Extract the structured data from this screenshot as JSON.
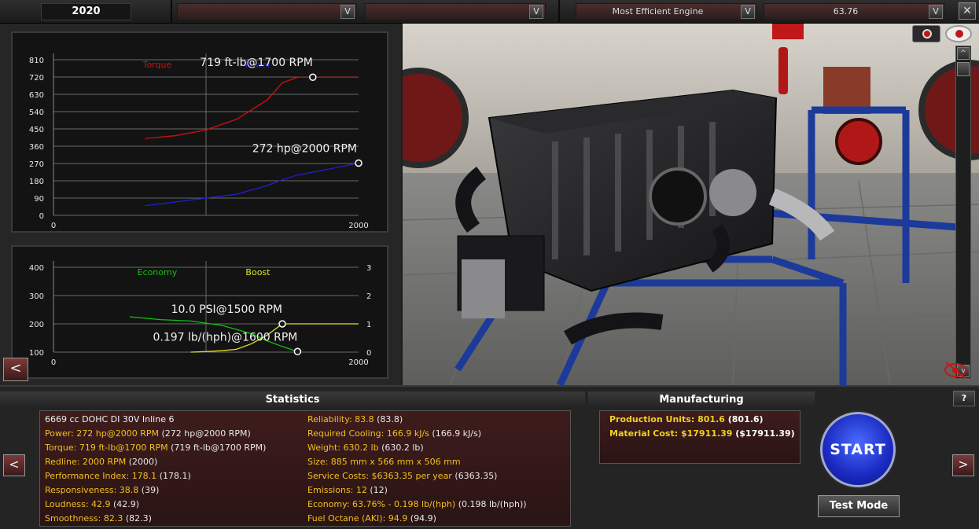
{
  "topbar": {
    "year": "2020",
    "dropdown1": "",
    "dropdown2": "",
    "dropdown3": "Most Efficient Engine",
    "dropdown4": "63.76",
    "arrow_glyph": "V",
    "close_glyph": "✕"
  },
  "chart_data": [
    {
      "type": "line",
      "title": "",
      "xlim": [
        0,
        2000
      ],
      "ylim": [
        0,
        810
      ],
      "x_ticks": [
        "0",
        "2000"
      ],
      "y_ticks": [
        "810",
        "720",
        "630",
        "540",
        "450",
        "360",
        "270",
        "180",
        "90",
        "0"
      ],
      "series": [
        {
          "name": "Torque",
          "color": "#d01010",
          "x": [
            600,
            800,
            1000,
            1200,
            1400,
            1500,
            1600,
            1700,
            1800,
            2000
          ],
          "y": [
            400,
            415,
            445,
            500,
            600,
            690,
            719,
            719,
            719,
            719
          ]
        },
        {
          "name": "Power",
          "color": "#2020d0",
          "x": [
            600,
            800,
            1000,
            1200,
            1400,
            1500,
            1600,
            1800,
            2000
          ],
          "y": [
            50,
            70,
            90,
            110,
            155,
            185,
            210,
            240,
            272
          ]
        }
      ],
      "annotations": [
        {
          "text": "719 ft-lb@1700 RPM",
          "x": 1700,
          "y": 719
        },
        {
          "text": "272 hp@2000 RPM",
          "x": 2000,
          "y": 272
        }
      ]
    },
    {
      "type": "line",
      "title": "",
      "xlim": [
        0,
        2000
      ],
      "ylim": [
        100,
        400
      ],
      "y2lim": [
        0,
        3
      ],
      "x_ticks": [
        "0",
        "2000"
      ],
      "y_ticks": [
        "400",
        "300",
        "200",
        "100"
      ],
      "y2_ticks": [
        "3",
        "2",
        "1",
        "0"
      ],
      "series": [
        {
          "name": "Economy",
          "color": "#10c010",
          "axis": "left",
          "x": [
            500,
            700,
            900,
            1100,
            1300,
            1400,
            1500,
            1600
          ],
          "y": [
            225,
            215,
            210,
            195,
            165,
            140,
            120,
            102
          ]
        },
        {
          "name": "Boost",
          "color": "#e0e020",
          "axis": "right",
          "x": [
            900,
            1000,
            1100,
            1200,
            1300,
            1400,
            1500,
            1700,
            2000
          ],
          "y": [
            0.0,
            0.02,
            0.05,
            0.1,
            0.3,
            0.6,
            1.0,
            1.0,
            1.0
          ]
        }
      ],
      "annotations": [
        {
          "text": "10.0 PSI@1500 RPM",
          "x": 1500,
          "y": 1.0,
          "axis": "right"
        },
        {
          "text": "0.197 lb/(hph)@1600 RPM",
          "x": 1600,
          "y": 102,
          "axis": "left"
        }
      ]
    }
  ],
  "left": {
    "back_glyph": "<"
  },
  "viewport": {
    "up_glyph": "^",
    "down_glyph": "v",
    "camera_icon": "camera-icon",
    "eye_icon": "eye-icon"
  },
  "statistics": {
    "header": "Statistics",
    "left_col": [
      {
        "label": "6669 cc DOHC DI 30V Inline 6",
        "base": ""
      },
      {
        "label": "Power: 272 hp@2000 RPM",
        "base": "(272 hp@2000 RPM)"
      },
      {
        "label": "Torque: 719 ft-lb@1700 RPM",
        "base": "(719 ft-lb@1700 RPM)"
      },
      {
        "label": "Redline: 2000 RPM",
        "base": "(2000)"
      },
      {
        "label": "Performance Index: 178.1",
        "base": "(178.1)"
      },
      {
        "label": "Responsiveness: 38.8",
        "base": "(39)"
      },
      {
        "label": "Loudness: 42.9",
        "base": "(42.9)"
      },
      {
        "label": "Smoothness: 82.3",
        "base": "(82.3)"
      }
    ],
    "right_col": [
      {
        "label": "Reliability: 83.8",
        "base": "(83.8)"
      },
      {
        "label": "Required Cooling: 166.9 kJ/s",
        "base": "(166.9 kJ/s)"
      },
      {
        "label": "Weight: 630.2 lb",
        "base": "(630.2 lb)"
      },
      {
        "label": "Size: 885 mm x 566 mm x 506 mm",
        "base": ""
      },
      {
        "label": "Service Costs: $6363.35 per year",
        "base": "(6363.35)"
      },
      {
        "label": "Emissions: 12",
        "base": "(12)"
      },
      {
        "label": "Economy: 63.76% - 0.198 lb/(hph)",
        "base": "(0.198 lb/(hph))"
      },
      {
        "label": "Fuel Octane (AKI): 94.9",
        "base": "(94.9)"
      }
    ]
  },
  "manufacturing": {
    "header": "Manufacturing",
    "rows": [
      {
        "label": "Production Units: 801.6",
        "base": "(801.6)"
      },
      {
        "label": "Material Cost: $17911.39",
        "base": "($17911.39)"
      }
    ]
  },
  "controls": {
    "start_label": "START",
    "test_label": "Test Mode",
    "help_label": "?",
    "prev_glyph": "<",
    "next_glyph": ">"
  },
  "colors": {
    "accent": "#2a3ae0",
    "stat_label": "#f0c020",
    "panel": "#3e1c1c"
  }
}
